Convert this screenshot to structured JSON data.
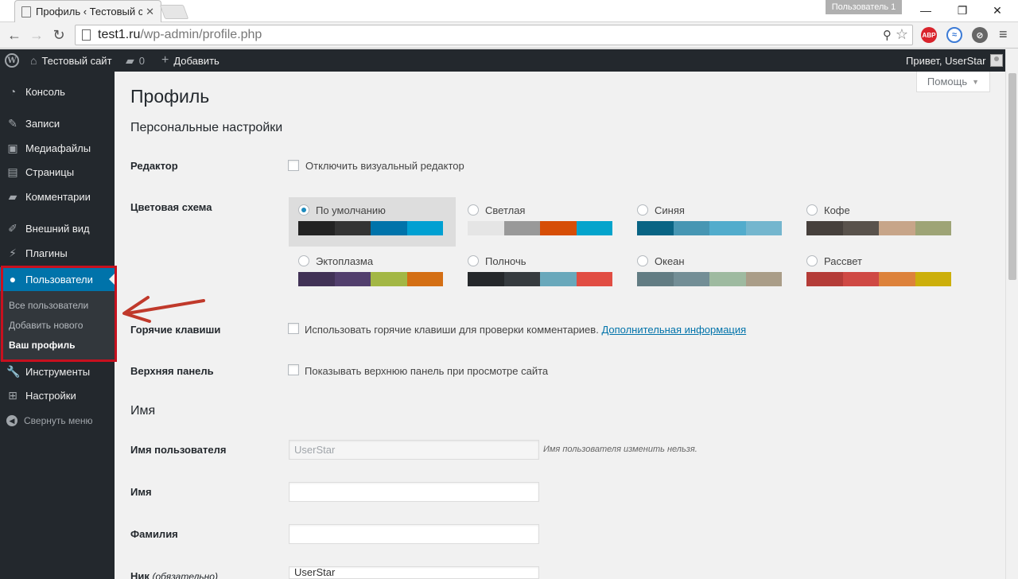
{
  "browser": {
    "tab_title": "Профиль ‹ Тестовый сайт",
    "profile_badge": "Пользователь 1",
    "url_host": "test1.ru",
    "url_path": "/wp-admin/profile.php",
    "ext_abp": "ABP"
  },
  "adminbar": {
    "site_name": "Тестовый сайт",
    "comments_count": "0",
    "add_new": "Добавить",
    "greeting": "Привет, UserStar"
  },
  "sidebar": {
    "items": [
      {
        "label": "Консоль",
        "icon": "dashboard-icon"
      },
      {
        "label": "Записи",
        "icon": "pin-icon"
      },
      {
        "label": "Медиафайлы",
        "icon": "media-icon"
      },
      {
        "label": "Страницы",
        "icon": "pages-icon"
      },
      {
        "label": "Комментарии",
        "icon": "comments-icon"
      },
      {
        "label": "Внешний вид",
        "icon": "brush-icon"
      },
      {
        "label": "Плагины",
        "icon": "plugin-icon"
      },
      {
        "label": "Пользователи",
        "icon": "users-icon"
      },
      {
        "label": "Инструменты",
        "icon": "tools-icon"
      },
      {
        "label": "Настройки",
        "icon": "settings-icon"
      }
    ],
    "submenu": [
      "Все пользователи",
      "Добавить нового",
      "Ваш профиль"
    ],
    "collapse": "Свернуть меню"
  },
  "main": {
    "help": "Помощь",
    "page_title": "Профиль",
    "personal_section": "Персональные настройки",
    "editor_label": "Редактор",
    "editor_option": "Отключить визуальный редактор",
    "scheme_label": "Цветовая схема",
    "schemes": [
      {
        "name": "По умолчанию",
        "colors": [
          "#222222",
          "#333333",
          "#0073aa",
          "#00a0d2"
        ],
        "selected": true
      },
      {
        "name": "Светлая",
        "colors": [
          "#e5e5e5",
          "#999999",
          "#d64e07",
          "#04a4cc"
        ]
      },
      {
        "name": "Синяя",
        "colors": [
          "#096484",
          "#4796b3",
          "#52accc",
          "#74b6ce"
        ]
      },
      {
        "name": "Кофе",
        "colors": [
          "#46403c",
          "#59524c",
          "#c7a589",
          "#9ea476"
        ]
      },
      {
        "name": "Эктоплазма",
        "colors": [
          "#413256",
          "#523f6d",
          "#a3b745",
          "#d46f15"
        ]
      },
      {
        "name": "Полночь",
        "colors": [
          "#25282b",
          "#363b3f",
          "#69a8bb",
          "#e14d43"
        ]
      },
      {
        "name": "Океан",
        "colors": [
          "#627c83",
          "#738e96",
          "#9ebaa0",
          "#aa9d88"
        ]
      },
      {
        "name": "Рассвет",
        "colors": [
          "#b43c38",
          "#cf4944",
          "#dd823b",
          "#ccaf0b"
        ]
      }
    ],
    "hotkeys_label": "Горячие клавиши",
    "hotkeys_option": "Использовать горячие клавиши для проверки комментариев.",
    "hotkeys_link": "Дополнительная информация",
    "toolbar_label": "Верхняя панель",
    "toolbar_option": "Показывать верхнюю панель при просмотре сайта",
    "name_section": "Имя",
    "username_label": "Имя пользователя",
    "username_value": "UserStar",
    "username_desc": "Имя пользователя изменить нельзя.",
    "first_name_label": "Имя",
    "last_name_label": "Фамилия",
    "nickname_label": "Ник",
    "nickname_required": "(обязательно)",
    "nickname_value": "UserStar"
  }
}
